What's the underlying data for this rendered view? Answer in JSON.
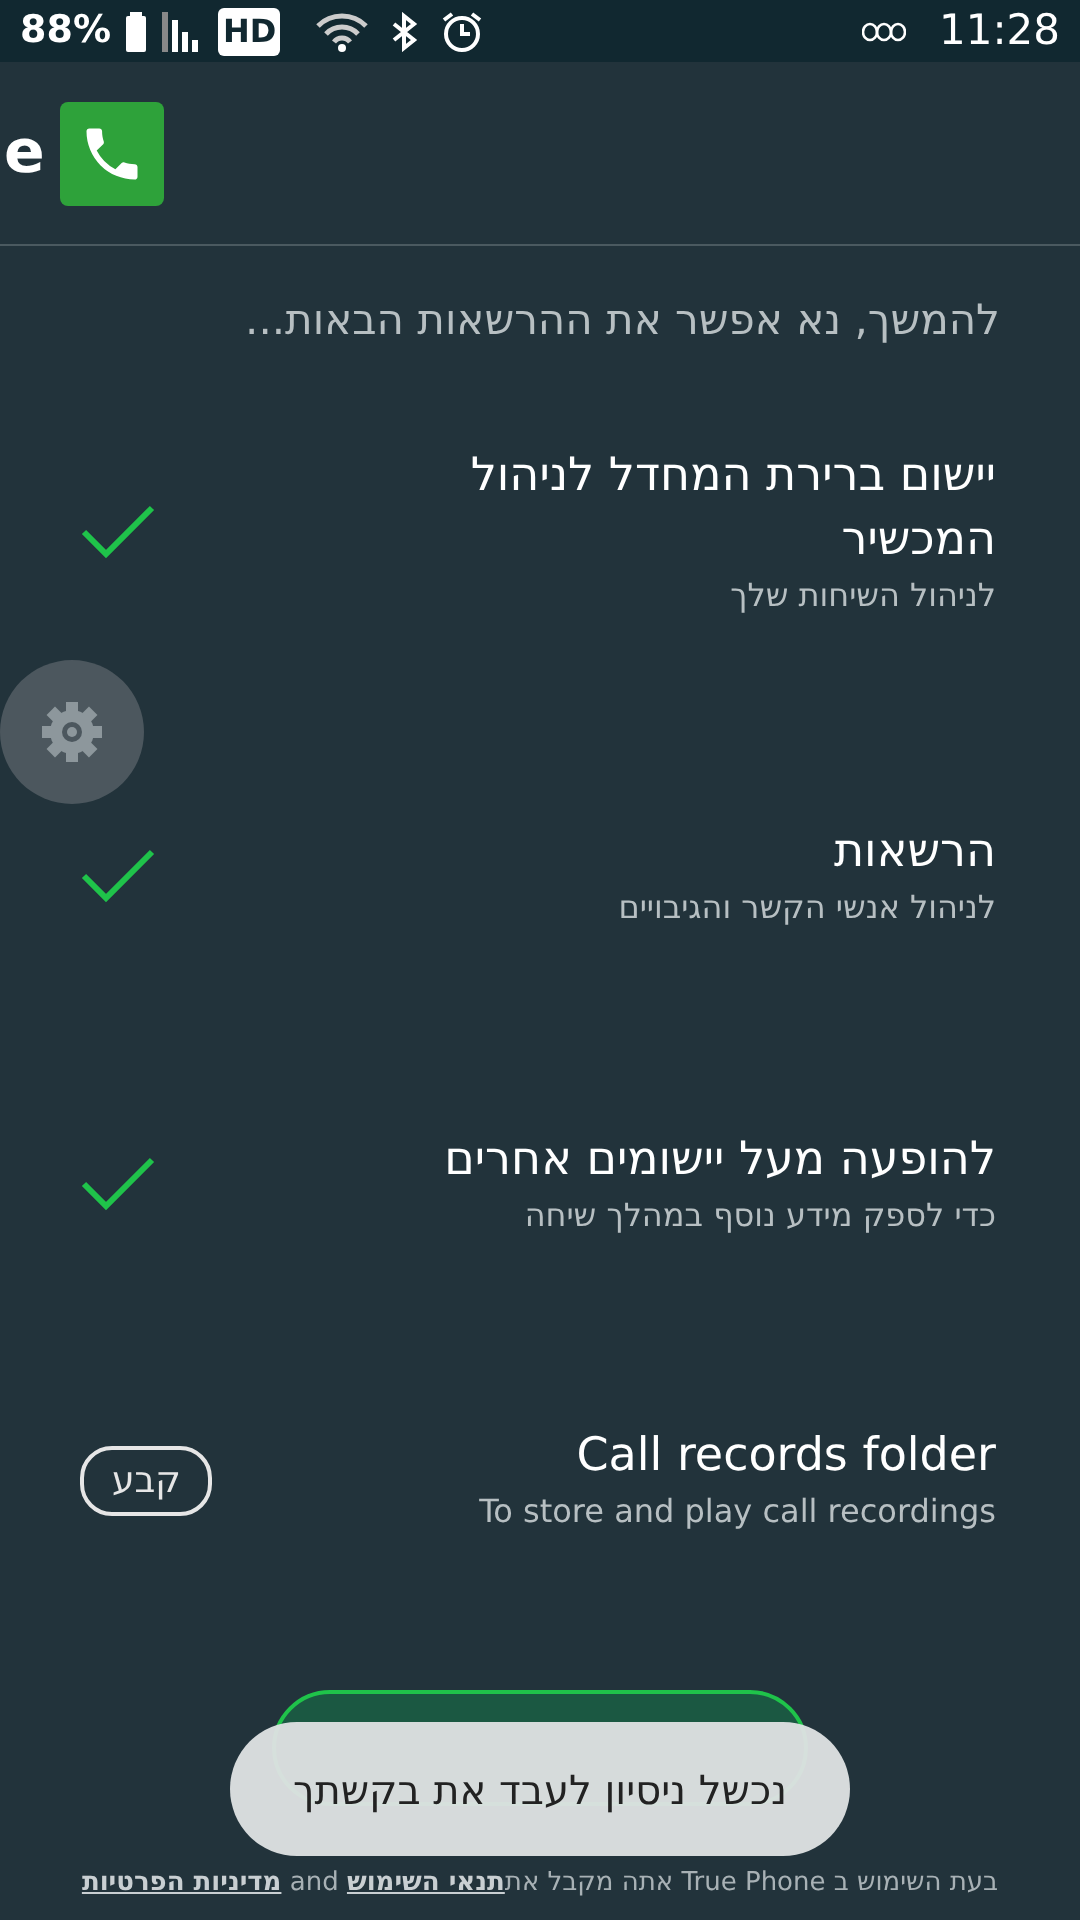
{
  "status_bar": {
    "battery": "88%",
    "network": "HD",
    "time": "11:28"
  },
  "header": {
    "title": "e"
  },
  "intro": "להמשך, נא אפשר את ההרשאות הבאות...",
  "permissions": [
    {
      "kind": "check",
      "title": "יישום ברירת המחדל לניהול המכשיר",
      "subtitle": "לניהול השיחות שלך",
      "granted": true
    },
    {
      "kind": "check",
      "title": "הרשאות",
      "subtitle": "לניהול אנשי הקשר והגיבויים",
      "granted": true
    },
    {
      "kind": "check",
      "title": "להופעה מעל יישומים אחרים",
      "subtitle": "כדי לספק מידע נוסף במהלך שיחה",
      "granted": true
    },
    {
      "kind": "button",
      "title": "Call records folder",
      "subtitle": "To store and play call recordings",
      "button": "קבע"
    }
  ],
  "next_button": {
    "shown": true
  },
  "toast": "נכשל ניסיון לעבד את בקשתך",
  "footer": {
    "text": "בעת השימוש ב True Phone אתה מקבל את",
    "terms_link": "תנאי השימוש",
    "joiner": "and",
    "privacy_link": "מדיניות הפרטיות"
  }
}
